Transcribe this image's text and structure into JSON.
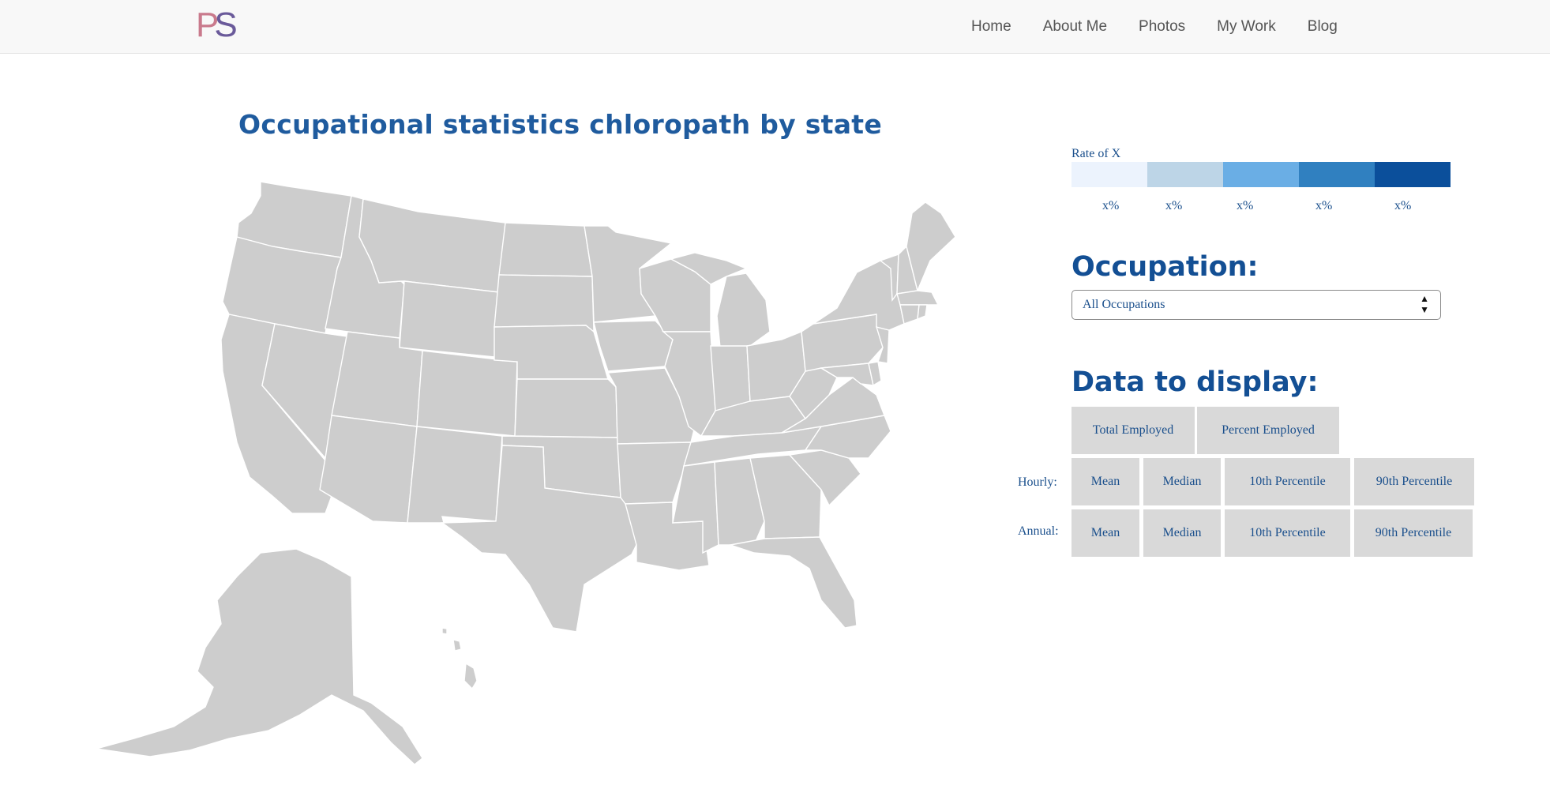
{
  "nav": {
    "logo_p": "P",
    "logo_s": "S",
    "links": [
      "Home",
      "About Me",
      "Photos",
      "My Work",
      "Blog"
    ]
  },
  "page": {
    "title": "Occupational statistics chloropath by state"
  },
  "legend": {
    "title": "Rate of X",
    "colors": [
      "#ecf3fd",
      "#bdd5e7",
      "#6aaee5",
      "#3080c0",
      "#0b4f9b"
    ],
    "labels": [
      "x%",
      "x%",
      "x%",
      "x%",
      "x%"
    ]
  },
  "occupation": {
    "heading": "Occupation:",
    "selected": "All Occupations"
  },
  "display": {
    "heading": "Data to display:",
    "top_buttons": [
      "Total Employed",
      "Percent Employed"
    ],
    "hourly_label": "Hourly:",
    "hourly_buttons": [
      "Mean",
      "Median",
      "10th Percentile",
      "90th Percentile"
    ],
    "annual_label": "Annual:",
    "annual_buttons": [
      "Mean",
      "Median",
      "10th Percentile",
      "90th Percentile"
    ]
  },
  "map": {
    "state_fill": "#cdcdcd"
  }
}
